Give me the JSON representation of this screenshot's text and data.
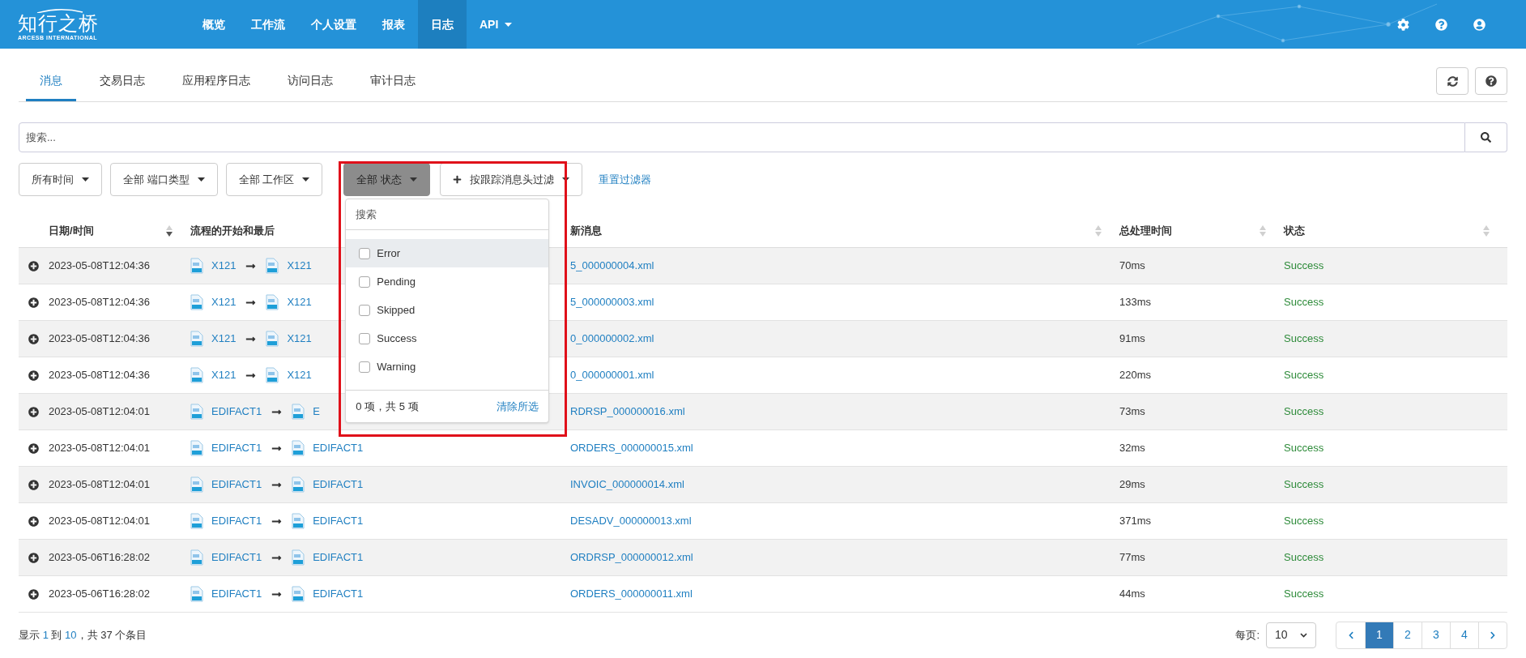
{
  "header": {
    "logo": {
      "title": "知行之桥",
      "subtitle": "ARCESB INTERNATIONAL"
    },
    "nav": [
      {
        "label": "概览",
        "selected": false,
        "caret": false
      },
      {
        "label": "工作流",
        "selected": false,
        "caret": false
      },
      {
        "label": "个人设置",
        "selected": false,
        "caret": false
      },
      {
        "label": "报表",
        "selected": false,
        "caret": false
      },
      {
        "label": "日志",
        "selected": true,
        "caret": false
      },
      {
        "label": "API",
        "selected": false,
        "caret": true
      }
    ]
  },
  "tabs": [
    {
      "label": "消息",
      "selected": true
    },
    {
      "label": "交易日志",
      "selected": false
    },
    {
      "label": "应用程序日志",
      "selected": false
    },
    {
      "label": "访问日志",
      "selected": false
    },
    {
      "label": "审计日志",
      "selected": false
    }
  ],
  "search": {
    "placeholder": "搜索..."
  },
  "filters": [
    {
      "label": "所有时间",
      "open": false,
      "plus": false
    },
    {
      "label": "全部 端口类型",
      "open": false,
      "plus": false
    },
    {
      "label": "全部 工作区",
      "open": false,
      "plus": false
    },
    {
      "label": "全部 状态",
      "open": true,
      "plus": false
    },
    {
      "label": "按跟踪消息头过滤",
      "open": false,
      "plus": true
    }
  ],
  "reset_link": "重置过滤器",
  "status_dropdown": {
    "placeholder": "搜索",
    "options": [
      {
        "label": "Error",
        "checked": false,
        "highlighted": true
      },
      {
        "label": "Pending",
        "checked": false,
        "highlighted": false
      },
      {
        "label": "Skipped",
        "checked": false,
        "highlighted": false
      },
      {
        "label": "Success",
        "checked": false,
        "highlighted": false
      },
      {
        "label": "Warning",
        "checked": false,
        "highlighted": false
      }
    ],
    "count": "0 项，共 5 项",
    "clear_link": "清除所选"
  },
  "table": {
    "columns": [
      {
        "label": "日期/时间",
        "sorted": true
      },
      {
        "label": "流程的开始和最后"
      },
      {
        "label": "新消息",
        "sorted": false
      },
      {
        "label": "总处理时间",
        "sorted": false
      },
      {
        "label": "状态",
        "sorted": false
      }
    ],
    "rows": [
      {
        "datetime": "2023-05-08T12:04:36",
        "from": "X121",
        "to": "X121",
        "message": "5_000000004.xml",
        "time": "70ms",
        "status": "Success"
      },
      {
        "datetime": "2023-05-08T12:04:36",
        "from": "X121",
        "to": "X121",
        "message": "5_000000003.xml",
        "time": "133ms",
        "status": "Success"
      },
      {
        "datetime": "2023-05-08T12:04:36",
        "from": "X121",
        "to": "X121",
        "message": "0_000000002.xml",
        "time": "91ms",
        "status": "Success"
      },
      {
        "datetime": "2023-05-08T12:04:36",
        "from": "X121",
        "to": "X121",
        "message": "0_000000001.xml",
        "time": "220ms",
        "status": "Success"
      },
      {
        "datetime": "2023-05-08T12:04:01",
        "from": "EDIFACT1",
        "to": "E",
        "message": "RDRSP_000000016.xml",
        "time": "73ms",
        "status": "Success"
      },
      {
        "datetime": "2023-05-08T12:04:01",
        "from": "EDIFACT1",
        "to": "EDIFACT1",
        "message": "ORDERS_000000015.xml",
        "time": "32ms",
        "status": "Success"
      },
      {
        "datetime": "2023-05-08T12:04:01",
        "from": "EDIFACT1",
        "to": "EDIFACT1",
        "message": "INVOIC_000000014.xml",
        "time": "29ms",
        "status": "Success"
      },
      {
        "datetime": "2023-05-08T12:04:01",
        "from": "EDIFACT1",
        "to": "EDIFACT1",
        "message": "DESADV_000000013.xml",
        "time": "371ms",
        "status": "Success"
      },
      {
        "datetime": "2023-05-06T16:28:02",
        "from": "EDIFACT1",
        "to": "EDIFACT1",
        "message": "ORDRSP_000000012.xml",
        "time": "77ms",
        "status": "Success"
      },
      {
        "datetime": "2023-05-06T16:28:02",
        "from": "EDIFACT1",
        "to": "EDIFACT1",
        "message": "ORDERS_000000011.xml",
        "time": "44ms",
        "status": "Success"
      }
    ]
  },
  "footer": {
    "info": {
      "prefix": "显示 ",
      "from": "1",
      "mid": " 到 ",
      "to": "10",
      "suffix": "，共 37 个条目"
    },
    "per_page_label": "每页:",
    "per_page": "10",
    "pages": [
      {
        "label": "1",
        "selected": true
      },
      {
        "label": "2",
        "selected": false
      },
      {
        "label": "3",
        "selected": false
      },
      {
        "label": "4",
        "selected": false
      }
    ]
  }
}
